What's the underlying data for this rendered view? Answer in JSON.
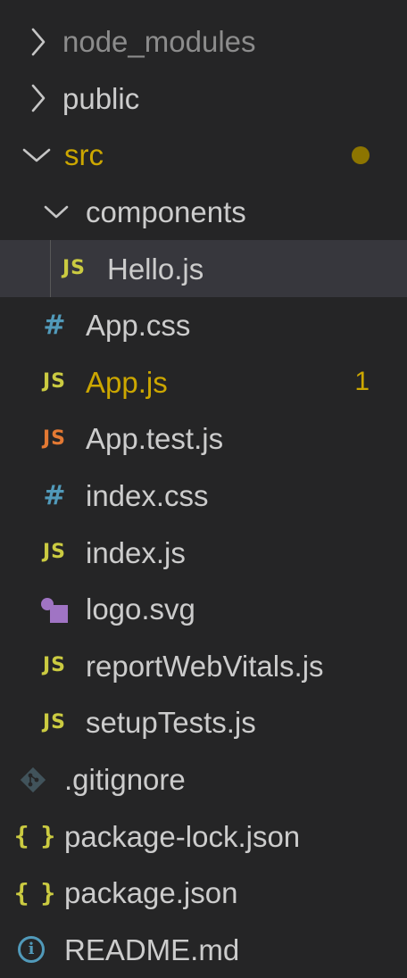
{
  "explorer": {
    "items": [
      {
        "label": "node_modules",
        "type": "folder",
        "expanded": false,
        "dimmed": true
      },
      {
        "label": "public",
        "type": "folder",
        "expanded": false
      },
      {
        "label": "src",
        "type": "folder",
        "expanded": true,
        "modified": true
      },
      {
        "label": "components",
        "type": "folder",
        "expanded": true
      },
      {
        "label": "Hello.js",
        "type": "file",
        "icon": "JS",
        "selected": true
      },
      {
        "label": "App.css",
        "type": "file",
        "icon": "#"
      },
      {
        "label": "App.js",
        "type": "file",
        "icon": "JS",
        "problems": "1"
      },
      {
        "label": "App.test.js",
        "type": "file",
        "icon": "JS"
      },
      {
        "label": "index.css",
        "type": "file",
        "icon": "#"
      },
      {
        "label": "index.js",
        "type": "file",
        "icon": "JS"
      },
      {
        "label": "logo.svg",
        "type": "file",
        "icon": "svg-shapes-icon"
      },
      {
        "label": "reportWebVitals.js",
        "type": "file",
        "icon": "JS"
      },
      {
        "label": "setupTests.js",
        "type": "file",
        "icon": "JS"
      },
      {
        "label": ".gitignore",
        "type": "file",
        "icon": "git-diamond-icon"
      },
      {
        "label": "package-lock.json",
        "type": "file",
        "icon": "{ }"
      },
      {
        "label": "package.json",
        "type": "file",
        "icon": "{ }"
      },
      {
        "label": "README.md",
        "type": "file",
        "icon": "i"
      }
    ]
  },
  "colors": {
    "background": "#252526",
    "selected_row": "#37373d",
    "text": "#cccccc",
    "modified": "#cca700",
    "js_icon": "#cbcb41",
    "test_icon": "#e37933",
    "css_icon": "#519aba",
    "svg_icon": "#a074c4"
  }
}
